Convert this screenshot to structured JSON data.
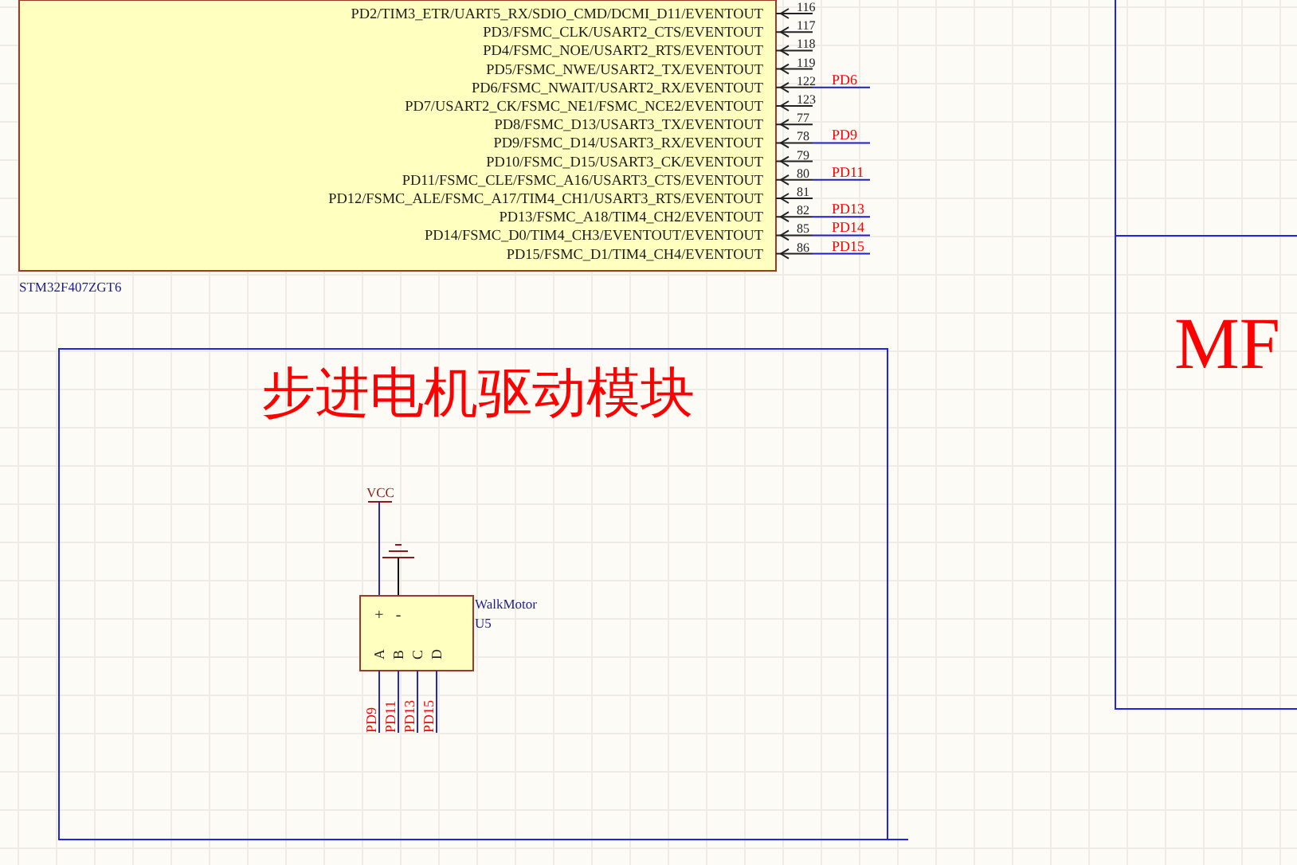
{
  "chip": {
    "name": "STM32F407ZGT6",
    "pins": [
      {
        "label": "PD2/TIM3_ETR/UART5_RX/SDIO_CMD/DCMI_D11/EVENTOUT",
        "number": "116"
      },
      {
        "label": "PD3/FSMC_CLK/USART2_CTS/EVENTOUT",
        "number": "117"
      },
      {
        "label": "PD4/FSMC_NOE/USART2_RTS/EVENTOUT",
        "number": "118"
      },
      {
        "label": "PD5/FSMC_NWE/USART2_TX/EVENTOUT",
        "number": "119"
      },
      {
        "label": "PD6/FSMC_NWAIT/USART2_RX/EVENTOUT",
        "number": "122",
        "net": "PD6"
      },
      {
        "label": "PD7/USART2_CK/FSMC_NE1/FSMC_NCE2/EVENTOUT",
        "number": "123"
      },
      {
        "label": "PD8/FSMC_D13/USART3_TX/EVENTOUT",
        "number": "77"
      },
      {
        "label": "PD9/FSMC_D14/USART3_RX/EVENTOUT",
        "number": "78",
        "net": "PD9"
      },
      {
        "label": "PD10/FSMC_D15/USART3_CK/EVENTOUT",
        "number": "79"
      },
      {
        "label": "PD11/FSMC_CLE/FSMC_A16/USART3_CTS/EVENTOUT",
        "number": "80",
        "net": "PD11"
      },
      {
        "label": "PD12/FSMC_ALE/FSMC_A17/TIM4_CH1/USART3_RTS/EVENTOUT",
        "number": "81"
      },
      {
        "label": "PD13/FSMC_A18/TIM4_CH2/EVENTOUT",
        "number": "82",
        "net": "PD13"
      },
      {
        "label": "PD14/FSMC_D0/TIM4_CH3/EVENTOUT/EVENTOUT",
        "number": "85",
        "net": "PD14"
      },
      {
        "label": "PD15/FSMC_D1/TIM4_CH4/EVENTOUT",
        "number": "86",
        "net": "PD15"
      }
    ]
  },
  "module": {
    "title": "步进电机驱动模块",
    "motor": {
      "power": "VCC",
      "name": "WalkMotor",
      "designator": "U5",
      "pins": [
        {
          "label": "+"
        },
        {
          "label": "-"
        }
      ],
      "signals": [
        {
          "label": "A",
          "net": "PD9"
        },
        {
          "label": "B",
          "net": "PD11"
        },
        {
          "label": "C",
          "net": "PD13"
        },
        {
          "label": "D",
          "net": "PD15"
        }
      ]
    }
  },
  "right_block": {
    "title": "MF"
  }
}
